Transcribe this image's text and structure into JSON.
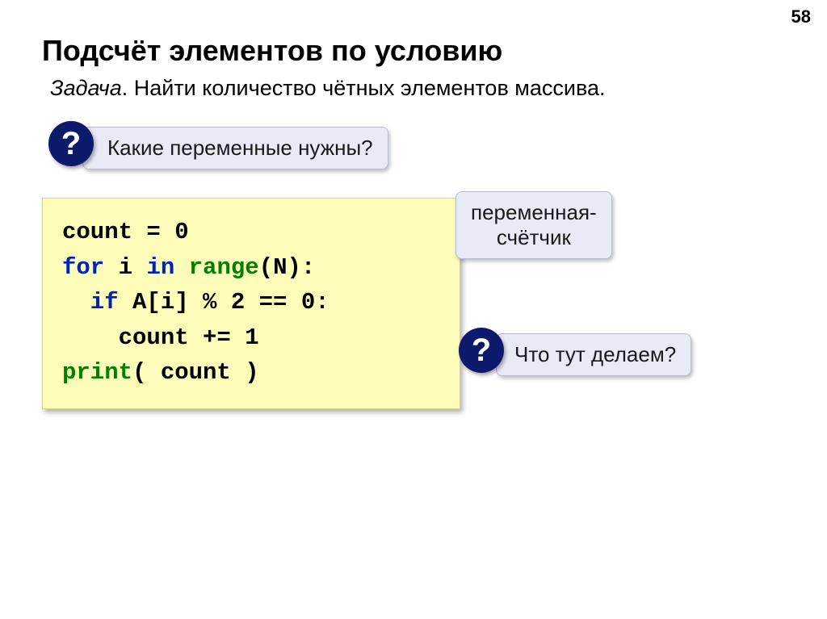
{
  "pageNumber": "58",
  "title": "Подсчёт элементов по условию",
  "task": {
    "label": "Задача",
    "text": ". Найти количество чётных элементов массива."
  },
  "callout1": {
    "text": "Какие переменные нужны?",
    "mark": "?"
  },
  "callout2": {
    "line1": "переменная-",
    "line2": "счётчик"
  },
  "callout3": {
    "text": "Что тут делаем?",
    "mark": "?"
  },
  "code": {
    "l1a": "count = 0",
    "l2a": "for",
    "l2b": " i ",
    "l2c": "in",
    "l2d": " range",
    "l2e": "(N):",
    "l3a": "  if",
    "l3b": " A[i] % 2 == 0:",
    "l4a": "    count += 1",
    "l5a": "print",
    "l5b": "( count )"
  }
}
